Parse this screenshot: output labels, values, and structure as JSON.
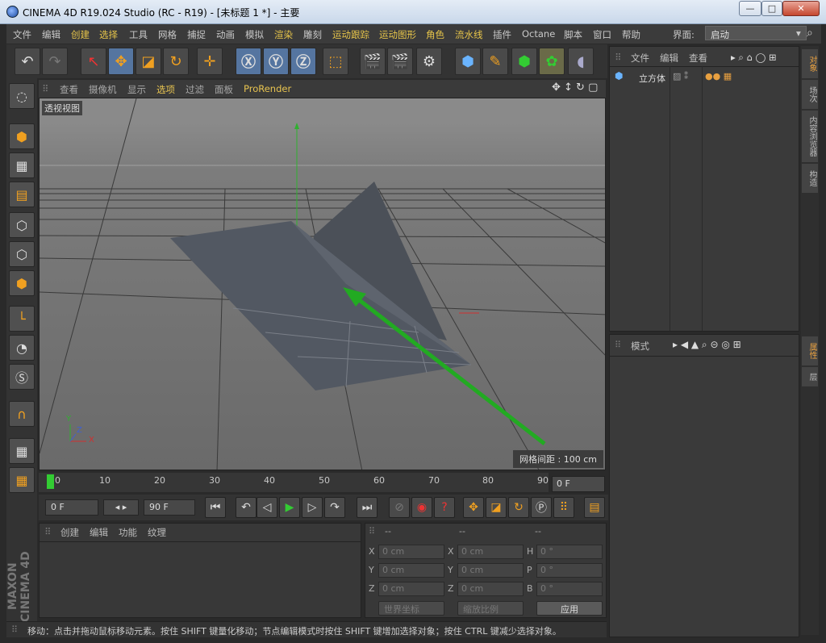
{
  "window": {
    "title": "CINEMA 4D R19.024 Studio (RC - R19) - [未标题 1 *] - 主要",
    "min_label": "—",
    "max_label": "□",
    "close_label": "✕"
  },
  "menubar": {
    "items": [
      "文件",
      "编辑",
      "创建",
      "选择",
      "工具",
      "网格",
      "捕捉",
      "动画",
      "模拟",
      "渲染",
      "雕刻",
      "运动跟踪",
      "运动图形",
      "角色",
      "流水线",
      "插件",
      "Octane",
      "脚本",
      "窗口",
      "帮助"
    ],
    "interface_label": "界面:",
    "interface_value": "启动"
  },
  "viewport": {
    "menu": [
      "查看",
      "摄像机",
      "显示",
      "选项",
      "过滤",
      "面板",
      "ProRender"
    ],
    "label": "透视视图",
    "grid_spacing": "网格间距 : 100 cm",
    "axis_x": "X",
    "axis_y": "Y",
    "axis_z": "Z"
  },
  "timeline": {
    "ticks": [
      "0",
      "10",
      "20",
      "30",
      "40",
      "50",
      "60",
      "70",
      "80",
      "90"
    ],
    "current_frame": "0 F",
    "start_frame": "0 F",
    "end_frame": "90 F"
  },
  "material_panel": {
    "menu": [
      "创建",
      "编辑",
      "功能",
      "纹理"
    ]
  },
  "coord_panel": {
    "header": [
      "--",
      "--",
      "--"
    ],
    "labels_left": [
      "X",
      "Y",
      "Z"
    ],
    "labels_mid": [
      "X",
      "Y",
      "Z"
    ],
    "labels_right": [
      "H",
      "P",
      "B"
    ],
    "pos": [
      "0 cm",
      "0 cm",
      "0 cm"
    ],
    "size": [
      "0 cm",
      "0 cm",
      "0 cm"
    ],
    "rot": [
      "0 °",
      "0 °",
      "0 °"
    ],
    "world_coords": "世界坐标",
    "scale_ratio": "缩放比例",
    "apply": "应用"
  },
  "object_panel": {
    "menu": [
      "文件",
      "编辑",
      "查看"
    ],
    "objects": [
      "立方体"
    ]
  },
  "attribute_panel": {
    "menu": [
      "模式"
    ]
  },
  "right_tabs": [
    "对象",
    "场次",
    "内容浏览器",
    "构造",
    "属性",
    "层"
  ],
  "status": "移动：点击并拖动鼠标移动元素。按住 SHIFT 键量化移动；节点编辑模式时按住 SHIFT 键增加选择对象；按住 CTRL 键减少选择对象。",
  "colors": {
    "accent": "#e8c450",
    "green_arrow": "#22aa22",
    "x_axis": "#d03030",
    "y_axis": "#30b030"
  }
}
